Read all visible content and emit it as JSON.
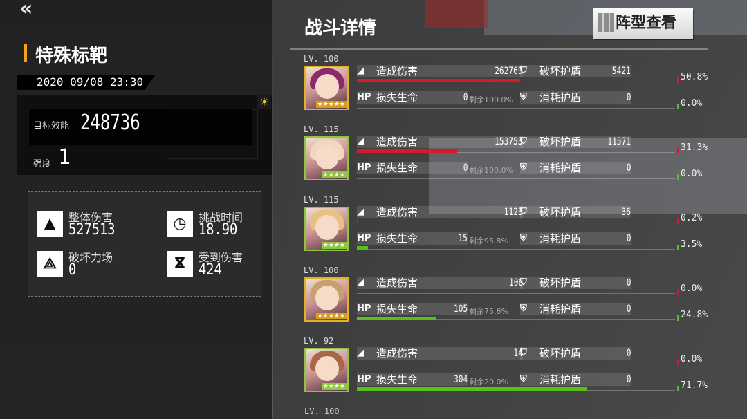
{
  "left": {
    "back_icon": "double-chevron-left",
    "title": "特殊标靶",
    "date": "2020 09/08 23:30",
    "efficiency_label": "目标效能",
    "efficiency_value": "248736",
    "strength_label": "强度",
    "strength_value": "1",
    "stats": [
      {
        "icon": "bullet-icon",
        "label": "整体伤害",
        "value": "527513"
      },
      {
        "icon": "clock-icon",
        "label": "挑战时间",
        "value": "18.90"
      },
      {
        "icon": "shield-break-icon",
        "label": "破坏力场",
        "value": "0"
      },
      {
        "icon": "injured-icon",
        "label": "受到伤害",
        "value": "424"
      }
    ]
  },
  "right": {
    "title": "战斗详情",
    "formation_button": "阵型查看"
  },
  "units": [
    {
      "level": "LV. 100",
      "rarity": "★★★★★",
      "frame": "gold",
      "hair": "#8a2a6a",
      "damage_label": "造成伤害",
      "damage": "262769",
      "damage_pct": "50.8%",
      "damage_frac": 0.508,
      "shield_break_label": "破坏护盾",
      "shield_break": "5421",
      "hp_label": "损失生命",
      "hp_lost": "0",
      "remain": "剩余100.0%",
      "shield_use_label": "消耗护盾",
      "shield_use": "0",
      "hp_pct": "0.0%",
      "hp_frac": 0.0
    },
    {
      "level": "LV. 115",
      "rarity": "★★★★",
      "frame": "green",
      "hair": "#f0d8c0",
      "damage_label": "造成伤害",
      "damage": "153753",
      "damage_pct": "31.3%",
      "damage_frac": 0.313,
      "shield_break_label": "破坏护盾",
      "shield_break": "11571",
      "hp_label": "损失生命",
      "hp_lost": "0",
      "remain": "剩余100.0%",
      "shield_use_label": "消耗护盾",
      "shield_use": "0",
      "hp_pct": "0.0%",
      "hp_frac": 0.0
    },
    {
      "level": "LV. 115",
      "rarity": "★★★★",
      "frame": "green",
      "hair": "#e8c080",
      "damage_label": "造成伤害",
      "damage": "1123",
      "damage_pct": "0.2%",
      "damage_frac": 0.002,
      "shield_break_label": "破坏护盾",
      "shield_break": "36",
      "hp_label": "损失生命",
      "hp_lost": "15",
      "remain": "剩余95.8%",
      "shield_use_label": "消耗护盾",
      "shield_use": "0",
      "hp_pct": "3.5%",
      "hp_frac": 0.035
    },
    {
      "level": "LV. 100",
      "rarity": "★★★★★",
      "frame": "gold",
      "hair": "#c8a070",
      "damage_label": "造成伤害",
      "damage": "106",
      "damage_pct": "0.0%",
      "damage_frac": 0.0,
      "shield_break_label": "破坏护盾",
      "shield_break": "0",
      "hp_label": "损失生命",
      "hp_lost": "105",
      "remain": "剩余75.6%",
      "shield_use_label": "消耗护盾",
      "shield_use": "0",
      "hp_pct": "24.8%",
      "hp_frac": 0.248
    },
    {
      "level": "LV. 92",
      "rarity": "★★★★",
      "frame": "green",
      "hair": "#a86848",
      "damage_label": "造成伤害",
      "damage": "14",
      "damage_pct": "0.0%",
      "damage_frac": 0.0,
      "shield_break_label": "破坏护盾",
      "shield_break": "0",
      "hp_label": "损失生命",
      "hp_lost": "304",
      "remain": "剩余20.0%",
      "shield_use_label": "消耗护盾",
      "shield_use": "0",
      "hp_pct": "71.7%",
      "hp_frac": 0.717
    }
  ],
  "next_level": "LV. 100",
  "colors": {
    "accent": "#f3a21a",
    "damage_bar": "#d9172d",
    "hp_bar": "#58c01a"
  }
}
